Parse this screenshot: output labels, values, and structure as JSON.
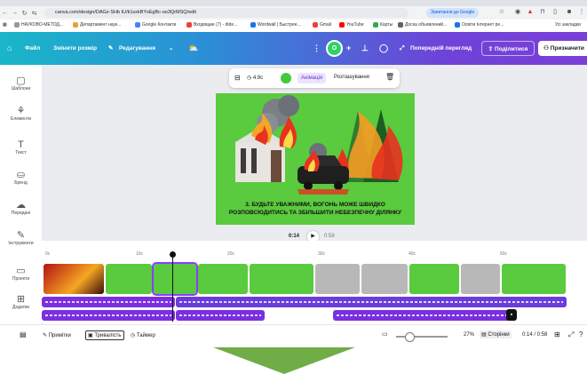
{
  "browser": {
    "url": "canva.com/design/DAGz-SHb tU/k1sxkBYsEgBc-oo3QrMSQ/edit",
    "signin_chip": "Запитання до Google",
    "bookmarks": [
      "НАУКОВО-МЕТОД...",
      "Департамент наук...",
      "Google Контакти",
      "Входящие (7) - dide...",
      "Wordwall | Быстрее...",
      "Gmail",
      "YouTube",
      "Карты",
      "Доска объявлений...",
      "Освіти Інтернет ре..."
    ],
    "bookmarks_all": "Усі закладки"
  },
  "topbar": {
    "home_icon": "home-icon",
    "file": "Файл",
    "resize": "Змінити розмір",
    "edit": "Редагування",
    "avatar_letter": "О",
    "preview": "Попередній перегляд",
    "share": "Поділитися",
    "publish": "Призначити"
  },
  "sidebar": [
    {
      "label": "Шаблони",
      "icon": "templates-icon",
      "glyph": "▢"
    },
    {
      "label": "Елементи",
      "icon": "elements-icon",
      "glyph": "⚘"
    },
    {
      "label": "Текст",
      "icon": "text-icon",
      "glyph": "T"
    },
    {
      "label": "Бренд",
      "icon": "brand-icon",
      "glyph": "⛀"
    },
    {
      "label": "Передані",
      "icon": "uploads-icon",
      "glyph": "☁"
    },
    {
      "label": "Інструменти",
      "icon": "draw-icon",
      "glyph": "✎"
    },
    {
      "label": "Проекти",
      "icon": "projects-icon",
      "glyph": "▭"
    },
    {
      "label": "Додатки",
      "icon": "apps-icon",
      "glyph": "⊞"
    }
  ],
  "context_bar": {
    "duration": "4.9с",
    "animation": "Анімація",
    "position": "Розташування"
  },
  "canvas": {
    "caption_line1": "3. БУДЬТЕ УВАЖНИМИ, ВОГОНЬ МОЖЕ ШВИДКО",
    "caption_line2": "РОЗПОВСЮДИТИСЬ ТА ЗБІЛЬШИТИ НЕБЕЗПЕЧНУ ДІЛЯНКУ"
  },
  "playback": {
    "current": "0:14",
    "total": "0:58"
  },
  "timeline": {
    "ticks": [
      "0с",
      "10с",
      "20с",
      "30с",
      "40с",
      "50с"
    ],
    "colors": {
      "audio": "#7b2fe0",
      "accent": "#8b3dff",
      "canvas_bg": "#5aca3e"
    }
  },
  "status": {
    "notes": "Примітки",
    "duration": "Тривалість",
    "timer": "Таймер",
    "zoom": "27%",
    "pages": "Сторінки",
    "page_time": "0:14 / 0:58"
  }
}
